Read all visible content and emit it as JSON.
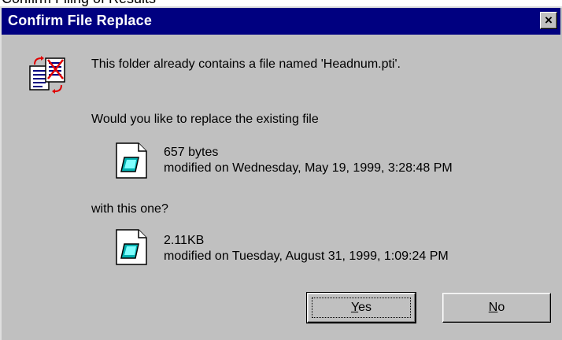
{
  "top_fragment": "Confirm Filing of Results",
  "window": {
    "title": "Confirm File Replace",
    "close_label": "×"
  },
  "message": {
    "contains": "This folder already contains a file named 'Headnum.pti'.",
    "question": "Would you like to replace the existing file",
    "with": "with this one?"
  },
  "existing_file": {
    "size": "657 bytes",
    "modified": "modified on Wednesday, May 19, 1999, 3:28:48 PM"
  },
  "new_file": {
    "size": "2.11KB",
    "modified": "modified on Tuesday, August 31, 1999, 1:09:24 PM"
  },
  "buttons": {
    "yes_mnemonic": "Y",
    "yes_rest": "es",
    "no_mnemonic": "N",
    "no_rest": "o"
  },
  "icons": {
    "main": "file-replace-icon",
    "existing": "document-icon",
    "new": "document-icon"
  }
}
